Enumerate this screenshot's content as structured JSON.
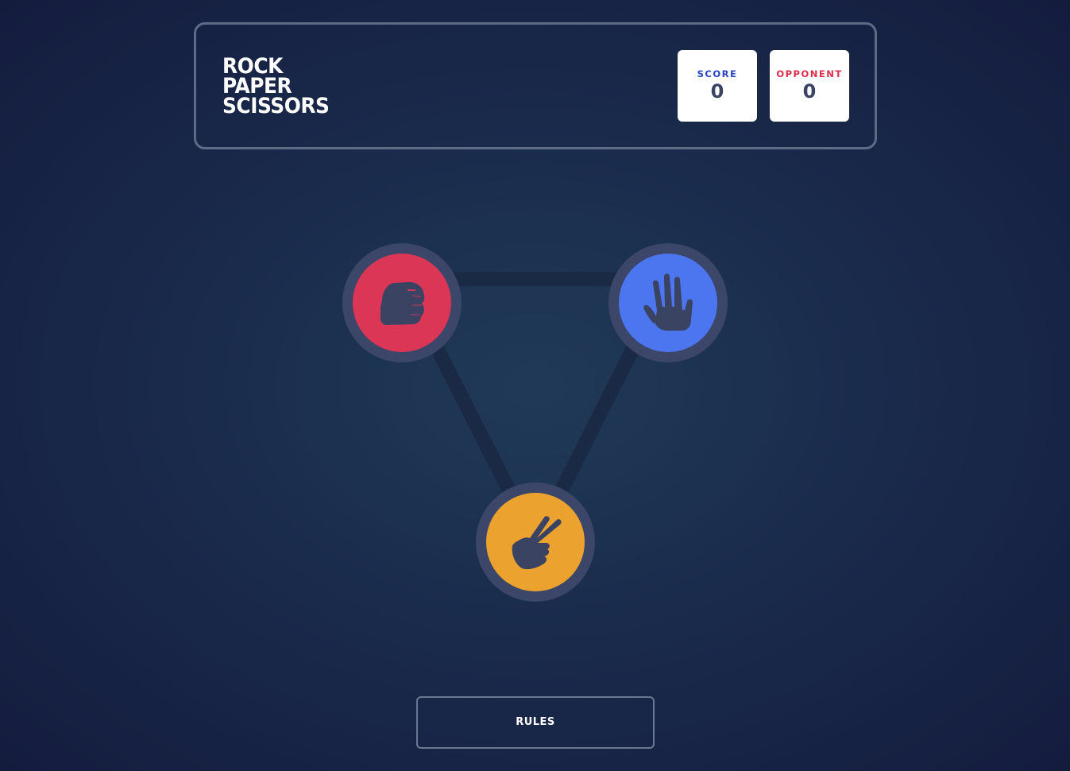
{
  "header": {
    "title_lines": [
      "ROCK",
      "PAPER",
      "SCISSORS"
    ],
    "score": {
      "label": "SCORE",
      "value": "0"
    },
    "opponent": {
      "label": "OPPONENT",
      "value": "0"
    }
  },
  "tokens": [
    {
      "name": "rock",
      "icon": "fist-icon",
      "color": "#dc3656"
    },
    {
      "name": "paper",
      "icon": "open-hand-icon",
      "color": "#4b76ef"
    },
    {
      "name": "scissors",
      "icon": "scissors-hand-icon",
      "color": "#eba22e"
    }
  ],
  "colors": {
    "ring": "#3b4668",
    "icon": "#3b4363",
    "connector": "#1a2a45",
    "score_label": "#2a46c0",
    "opponent_label": "#db2e4d"
  },
  "rules_button": {
    "label": "RULES"
  }
}
